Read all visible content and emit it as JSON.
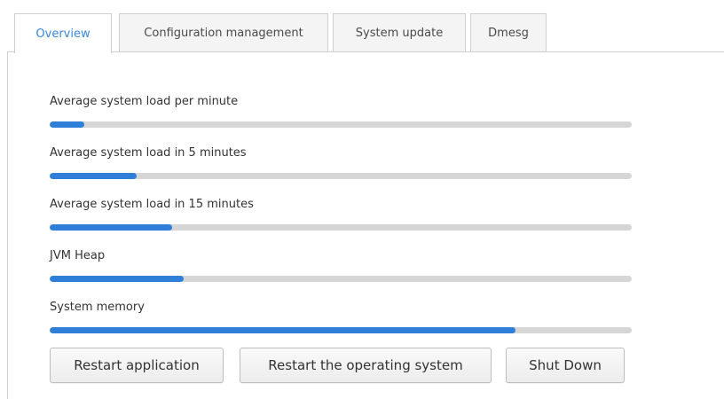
{
  "tabs": [
    {
      "label": "Overview",
      "active": true
    },
    {
      "label": "Configuration management",
      "active": false
    },
    {
      "label": "System update",
      "active": false
    },
    {
      "label": "Dmesg",
      "active": false
    }
  ],
  "metrics": [
    {
      "label": "Average system load per minute",
      "progress_percent": 6
    },
    {
      "label": "Average system load in 5 minutes",
      "progress_percent": 15
    },
    {
      "label": "Average system load in 15 minutes",
      "progress_percent": 21
    },
    {
      "label": "JVM Heap",
      "progress_percent": 23
    },
    {
      "label": "System memory",
      "progress_percent": 80
    }
  ],
  "buttons": {
    "restart_app": "Restart application",
    "restart_os": "Restart the operating system",
    "shutdown": "Shut Down"
  },
  "colors": {
    "accent": "#2f7fd9",
    "active_tab_text": "#3b86d8",
    "track": "#d6d6d6"
  }
}
